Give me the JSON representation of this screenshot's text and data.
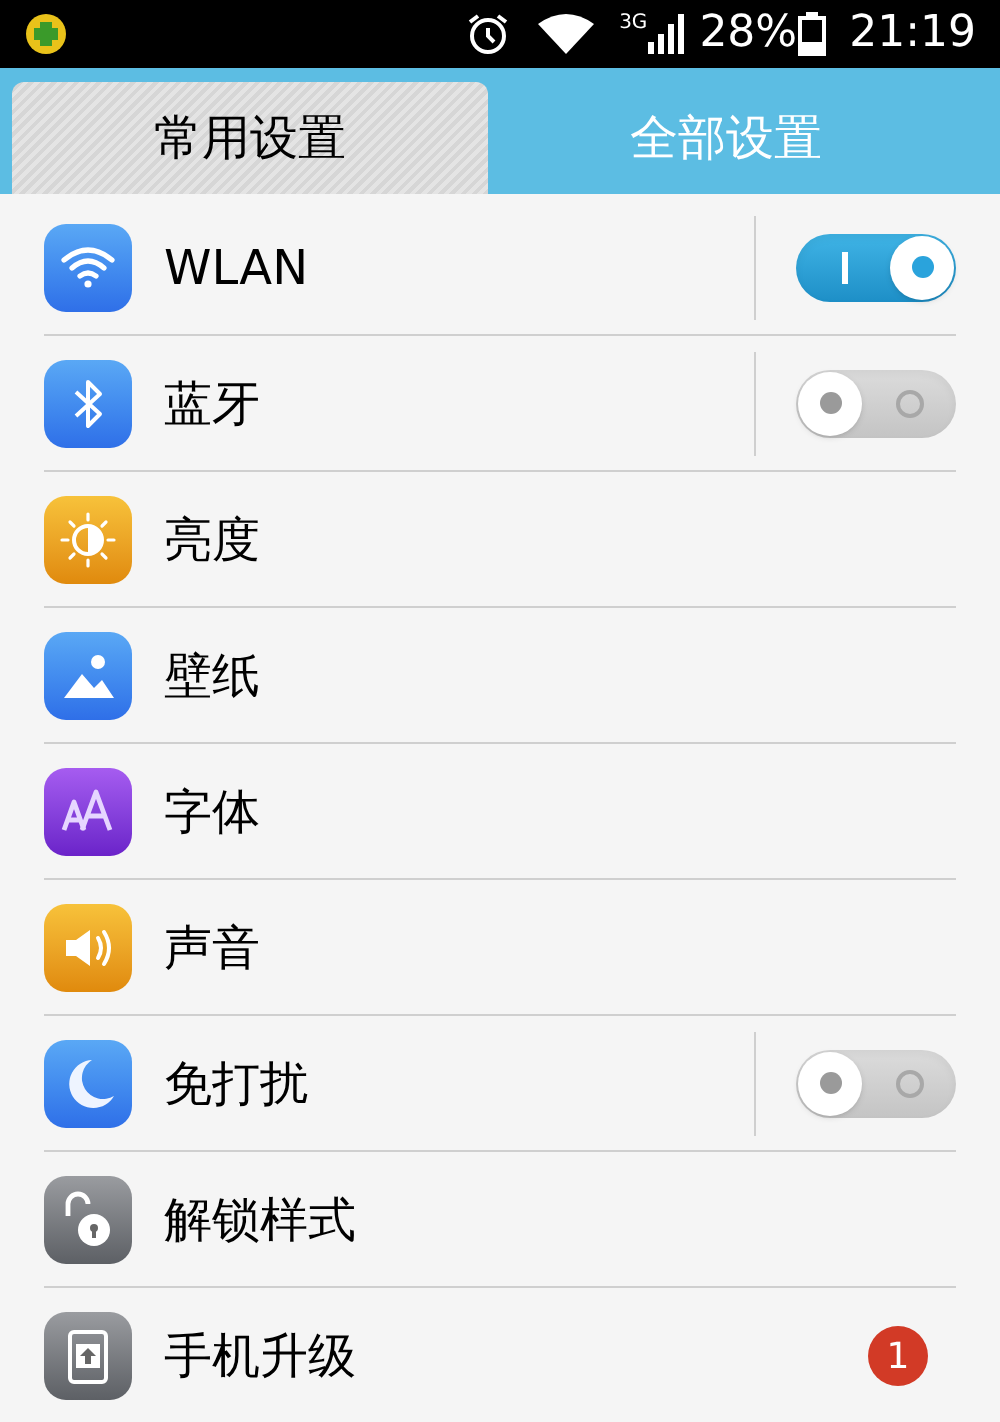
{
  "status_bar": {
    "network": "3G",
    "battery": "28%",
    "time": "21:19"
  },
  "tabs": [
    {
      "label": "常用设置",
      "selected": true
    },
    {
      "label": "全部设置",
      "selected": false
    }
  ],
  "items": [
    {
      "label": "WLAN",
      "kind": "toggle",
      "on": true
    },
    {
      "label": "蓝牙",
      "kind": "toggle",
      "on": false
    },
    {
      "label": "亮度",
      "kind": "plain"
    },
    {
      "label": "壁纸",
      "kind": "plain"
    },
    {
      "label": "字体",
      "kind": "plain"
    },
    {
      "label": "声音",
      "kind": "plain"
    },
    {
      "label": "免打扰",
      "kind": "toggle",
      "on": false
    },
    {
      "label": "解锁样式",
      "kind": "plain"
    },
    {
      "label": "手机升级",
      "kind": "badge",
      "badge": "1"
    }
  ]
}
